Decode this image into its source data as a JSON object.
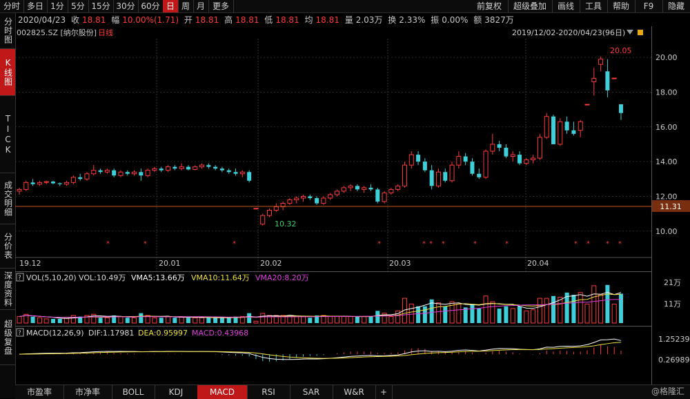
{
  "toolbar": {
    "left": [
      "分时",
      "多日",
      "1分",
      "5分",
      "15分",
      "30分",
      "60分",
      "日",
      "周",
      "月",
      "更多"
    ],
    "active": "日",
    "right": [
      "前复权",
      "超级叠加",
      "画线",
      "工具",
      "帮助",
      "F9",
      "隐藏"
    ]
  },
  "quote": {
    "date": "2020/04/23",
    "close_label": "收",
    "close": "18.81",
    "change_label": "幅",
    "change": "10.00%(1.71)",
    "open_label": "开",
    "open": "18.81",
    "high_label": "高",
    "high": "18.81",
    "low_label": "低",
    "low": "18.81",
    "avg_label": "均",
    "avg": "18.81",
    "volume_label": "量",
    "volume": "2.03万",
    "turnover_label": "换",
    "turnover": "2.33%",
    "amplitude_label": "振",
    "amplitude": "0.00%",
    "amount_label": "额",
    "amount": "3827万"
  },
  "left_tabs": [
    "分时图",
    "K线图",
    "TICK",
    "成交明细",
    "分价表",
    "深度资料",
    "超级复盘"
  ],
  "left_active": "K线图",
  "bottom_tabs": [
    "市盈率",
    "市净率",
    "BOLL",
    "KDJ",
    "MACD",
    "RSI",
    "SAR",
    "W&R",
    "+"
  ],
  "bottom_active": "MACD",
  "watermark": "@格隆汇",
  "main_chart": {
    "stock": "002825.SZ [纳尔股份]",
    "period": "日线",
    "range": "2019/12/02-2020/04/23(96日)",
    "price_label": "11.31",
    "high_annotation": "20.05",
    "low_annotation": "10.32"
  },
  "vol_panel": {
    "title": "VOL(5,10,20)",
    "vol": "VOL:10.49万",
    "ma5": "VMA5:13.66万",
    "ma10": "VMA10:11.64万",
    "ma20": "VMA20:8.20万",
    "tick_hi": "21万",
    "tick_mid": "11万"
  },
  "macd_panel": {
    "title": "MACD(12,26,9)",
    "dif": "DIF:1.17981",
    "dea": "DEA:0.95997",
    "macd": "MACD:0.43968",
    "tick_hi": "1.25239",
    "tick_lo": "0.26989"
  },
  "colors": {
    "up": "#ff3b3b",
    "down": "#3ecfd8",
    "active_tab": "#c01818",
    "ma5": "#ffffff",
    "ma10": "#f0e040",
    "ma20": "#e040e0"
  },
  "chart_data": {
    "type": "candlestick",
    "x_ticks": [
      "19.12",
      "20.01",
      "20.02",
      "20.03",
      "20.04"
    ],
    "y_ticks": [
      "20.00",
      "18.00",
      "16.00",
      "14.00",
      "12.00",
      "10.00"
    ],
    "ylim": [
      8.6,
      21.0
    ],
    "candles": [
      [
        12.3,
        12.5,
        12.1,
        12.4
      ],
      [
        12.4,
        12.9,
        12.3,
        12.8
      ],
      [
        12.8,
        13.0,
        12.6,
        12.7
      ],
      [
        12.7,
        12.9,
        12.6,
        12.8
      ],
      [
        12.8,
        12.9,
        12.7,
        12.85
      ],
      [
        12.85,
        12.9,
        12.7,
        12.75
      ],
      [
        12.75,
        12.8,
        12.6,
        12.7
      ],
      [
        12.7,
        12.9,
        12.6,
        12.8
      ],
      [
        12.8,
        13.2,
        12.7,
        13.1
      ],
      [
        13.1,
        13.3,
        12.9,
        13.0
      ],
      [
        13.0,
        13.4,
        12.9,
        13.3
      ],
      [
        13.3,
        13.8,
        13.2,
        13.5
      ],
      [
        13.5,
        13.6,
        13.3,
        13.4
      ],
      [
        13.4,
        13.6,
        13.3,
        13.5
      ],
      [
        13.5,
        13.6,
        13.1,
        13.2
      ],
      [
        13.2,
        13.5,
        13.1,
        13.4
      ],
      [
        13.4,
        13.5,
        13.2,
        13.3
      ],
      [
        13.3,
        13.5,
        13.2,
        13.4
      ],
      [
        13.4,
        13.6,
        12.9,
        13.2
      ],
      [
        13.2,
        13.6,
        13.1,
        13.5
      ],
      [
        13.5,
        13.7,
        13.4,
        13.6
      ],
      [
        13.6,
        13.7,
        13.4,
        13.5
      ],
      [
        13.5,
        13.8,
        13.4,
        13.7
      ],
      [
        13.7,
        13.8,
        13.5,
        13.6
      ],
      [
        13.6,
        13.9,
        13.5,
        13.7
      ],
      [
        13.7,
        13.8,
        13.5,
        13.55
      ],
      [
        13.55,
        13.8,
        13.5,
        13.7
      ],
      [
        13.7,
        13.9,
        13.6,
        13.8
      ],
      [
        13.8,
        13.9,
        13.6,
        13.7
      ],
      [
        13.7,
        13.8,
        13.5,
        13.6
      ],
      [
        13.6,
        13.7,
        13.4,
        13.5
      ],
      [
        13.5,
        13.6,
        13.3,
        13.4
      ],
      [
        13.4,
        13.6,
        13.2,
        13.3
      ],
      [
        13.3,
        13.5,
        13.1,
        13.4
      ],
      [
        13.4,
        13.5,
        12.8,
        12.9
      ],
      [
        11.31,
        11.31,
        11.31,
        11.31
      ],
      [
        10.4,
        11.0,
        10.32,
        10.9
      ],
      [
        10.9,
        11.3,
        10.8,
        11.2
      ],
      [
        11.2,
        11.6,
        11.1,
        11.4
      ],
      [
        11.4,
        11.7,
        11.2,
        11.6
      ],
      [
        11.6,
        11.9,
        11.5,
        11.8
      ],
      [
        11.8,
        12.0,
        11.6,
        11.9
      ],
      [
        11.9,
        12.1,
        11.7,
        12.0
      ],
      [
        12.0,
        12.1,
        11.8,
        11.9
      ],
      [
        11.9,
        12.0,
        11.5,
        11.6
      ],
      [
        11.6,
        12.0,
        11.5,
        11.9
      ],
      [
        11.9,
        12.2,
        11.8,
        12.1
      ],
      [
        12.1,
        12.4,
        12.0,
        12.3
      ],
      [
        12.3,
        12.6,
        12.2,
        12.5
      ],
      [
        12.5,
        12.7,
        12.3,
        12.6
      ],
      [
        12.6,
        12.7,
        12.3,
        12.4
      ],
      [
        12.4,
        12.6,
        12.2,
        12.5
      ],
      [
        12.5,
        12.7,
        12.3,
        12.4
      ],
      [
        12.4,
        12.5,
        11.6,
        11.7
      ],
      [
        11.7,
        12.3,
        11.6,
        12.2
      ],
      [
        12.2,
        12.5,
        12.1,
        12.4
      ],
      [
        12.4,
        12.7,
        12.3,
        12.6
      ],
      [
        12.6,
        14.0,
        12.5,
        13.8
      ],
      [
        13.8,
        14.6,
        13.6,
        14.4
      ],
      [
        14.4,
        14.6,
        13.8,
        14.0
      ],
      [
        14.0,
        14.2,
        13.4,
        13.5
      ],
      [
        13.5,
        13.8,
        12.4,
        12.6
      ],
      [
        12.6,
        13.6,
        12.5,
        13.4
      ],
      [
        13.4,
        13.6,
        12.8,
        12.9
      ],
      [
        12.9,
        14.0,
        12.8,
        13.8
      ],
      [
        13.8,
        14.6,
        13.6,
        14.3
      ],
      [
        14.3,
        14.5,
        13.8,
        14.0
      ],
      [
        14.0,
        14.2,
        13.2,
        13.3
      ],
      [
        13.3,
        13.6,
        13.0,
        13.1
      ],
      [
        13.1,
        14.7,
        13.0,
        14.6
      ],
      [
        14.6,
        15.6,
        14.4,
        15.0
      ],
      [
        15.0,
        15.2,
        14.6,
        14.8
      ],
      [
        14.8,
        15.0,
        14.2,
        14.3
      ],
      [
        14.3,
        14.6,
        14.0,
        14.4
      ],
      [
        14.4,
        14.6,
        13.8,
        13.9
      ],
      [
        13.9,
        14.2,
        13.8,
        14.1
      ],
      [
        14.1,
        14.4,
        13.9,
        14.2
      ],
      [
        14.2,
        15.6,
        14.1,
        15.4
      ],
      [
        15.4,
        16.8,
        15.3,
        16.6
      ],
      [
        16.6,
        16.7,
        15.0,
        15.0
      ],
      [
        15.0,
        16.5,
        14.9,
        16.3
      ],
      [
        16.3,
        16.6,
        15.6,
        15.8
      ],
      [
        15.8,
        16.3,
        15.5,
        15.6
      ],
      [
        15.8,
        16.4,
        15.4,
        16.3
      ],
      [
        17.3,
        17.3,
        17.3,
        17.3
      ],
      [
        18.6,
        19.4,
        17.8,
        18.8
      ],
      [
        19.6,
        20.05,
        19.2,
        19.9
      ],
      [
        19.2,
        19.9,
        17.7,
        18.1
      ],
      [
        18.81,
        18.81,
        18.81,
        18.81
      ],
      [
        17.3,
        17.3,
        16.4,
        16.8
      ]
    ],
    "volume_ylim": [
      0,
      21
    ],
    "macd_ylim": [
      -1.2,
      1.4
    ]
  }
}
